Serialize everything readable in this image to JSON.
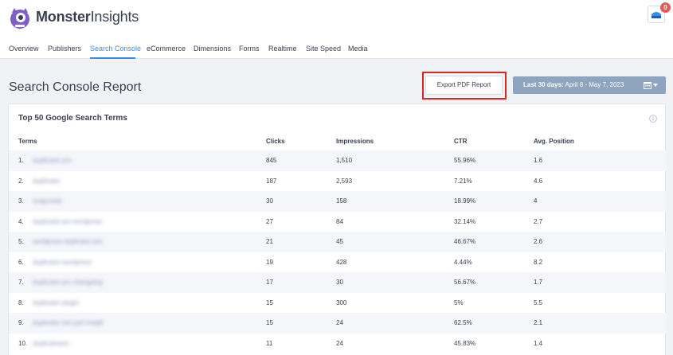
{
  "header": {
    "brand_part1": "Monster",
    "brand_part2": "Insights",
    "notification_count": "0"
  },
  "tabs": [
    {
      "label": "Overview",
      "active": false
    },
    {
      "label": "Publishers",
      "active": false
    },
    {
      "label": "Search Console",
      "active": true
    },
    {
      "label": "eCommerce",
      "active": false
    },
    {
      "label": "Dimensions",
      "active": false
    },
    {
      "label": "Forms",
      "active": false
    },
    {
      "label": "Realtime",
      "active": false
    },
    {
      "label": "Site Speed",
      "active": false
    },
    {
      "label": "Media",
      "active": false
    }
  ],
  "page": {
    "title": "Search Console Report",
    "export_label": "Export PDF Report",
    "date_range_bold": "Last 30 days:",
    "date_range_value": " April 8 - May 7, 2023"
  },
  "card": {
    "title": "Top 50 Google Search Terms",
    "columns": [
      "Terms",
      "Clicks",
      "Impressions",
      "CTR",
      "Avg. Position"
    ],
    "rows": [
      {
        "num": "1.",
        "term": "duplicator pro",
        "clicks": "845",
        "impressions": "1,510",
        "ctr": "55.96%",
        "position": "1.6"
      },
      {
        "num": "2.",
        "term": "duplicator",
        "clicks": "187",
        "impressions": "2,593",
        "ctr": "7.21%",
        "position": "4.6"
      },
      {
        "num": "3.",
        "term": "snapcreek",
        "clicks": "30",
        "impressions": "158",
        "ctr": "18.99%",
        "position": "4"
      },
      {
        "num": "4.",
        "term": "duplicator pro wordpress",
        "clicks": "27",
        "impressions": "84",
        "ctr": "32.14%",
        "position": "2.7"
      },
      {
        "num": "5.",
        "term": "wordpress duplicator pro",
        "clicks": "21",
        "impressions": "45",
        "ctr": "46.67%",
        "position": "2.6"
      },
      {
        "num": "6.",
        "term": "duplicator wordpress",
        "clicks": "19",
        "impressions": "428",
        "ctr": "4.44%",
        "position": "8.2"
      },
      {
        "num": "7.",
        "term": "duplicator pro changelog",
        "clicks": "17",
        "impressions": "30",
        "ctr": "56.67%",
        "position": "1.7"
      },
      {
        "num": "8.",
        "term": "duplicator plugin",
        "clicks": "15",
        "impressions": "300",
        "ctr": "5%",
        "position": "5.5"
      },
      {
        "num": "9.",
        "term": "duplicator two part install",
        "clicks": "15",
        "impressions": "24",
        "ctr": "62.5%",
        "position": "2.1"
      },
      {
        "num": "10.",
        "term": "duplicatorpro",
        "clicks": "11",
        "impressions": "24",
        "ctr": "45.83%",
        "position": "1.4"
      }
    ]
  },
  "colors": {
    "accent": "#338eef",
    "date_button": "#8ea4bf",
    "highlight_outline": "#e02424",
    "badge": "#eb5757",
    "logo_purple": "#7f5fc7"
  }
}
